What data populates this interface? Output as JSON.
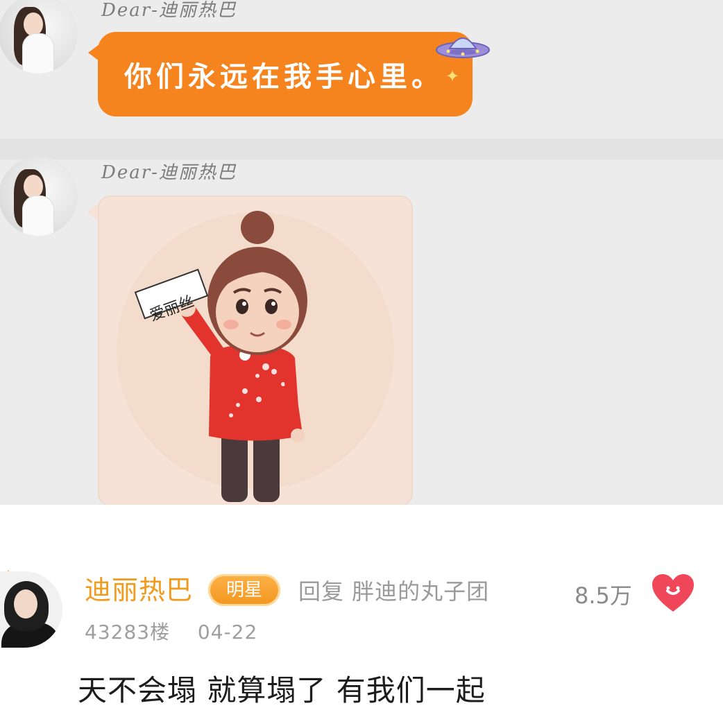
{
  "chat": {
    "messages": [
      {
        "sender": "Dear-迪丽热巴",
        "text": "你们永远在我手心里。"
      },
      {
        "sender": "Dear-迪丽热巴",
        "sticker_sign": "爱丽丝"
      }
    ]
  },
  "comment": {
    "author": "迪丽热巴",
    "badge": "明星",
    "reply": "回复 胖迪的丸子团",
    "likes": "8.5万",
    "floor": "43283楼",
    "date": "04-22",
    "text": "天不会塌 就算塌了 有我们一起"
  },
  "icons": {
    "ufo": "ufo-icon",
    "sparkle": "sparkle-icon",
    "heart": "heart-icon",
    "crown": "crown-icon"
  },
  "colors": {
    "bubble": "#f5841f",
    "name": "#f29a1c",
    "heart": "#f0465a"
  }
}
